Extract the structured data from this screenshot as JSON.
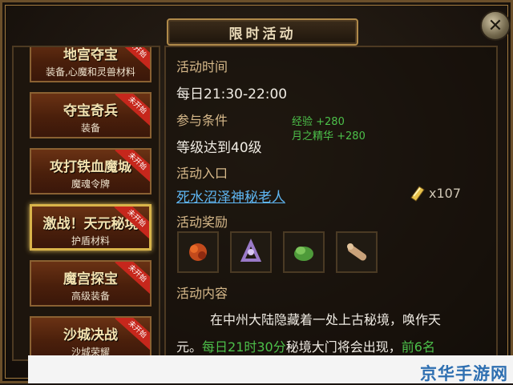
{
  "window": {
    "title": "限时活动",
    "close_symbol": "✕"
  },
  "sidebar": {
    "items": [
      {
        "title": "地宫夺宝",
        "sub": "装备,心魔和灵兽材料",
        "ribbon": "未开始"
      },
      {
        "title": "夺宝奇兵",
        "sub": "装备",
        "ribbon": "未开始"
      },
      {
        "title": "攻打铁血魔城",
        "sub": "魔魂令牌",
        "ribbon": "未开始"
      },
      {
        "title": "激战！天元秘境",
        "sub": "护盾材料",
        "ribbon": "未开始",
        "active": true
      },
      {
        "title": "魔宫探宝",
        "sub": "高级装备",
        "ribbon": "未开始"
      },
      {
        "title": "沙城决战",
        "sub": "沙城荣耀",
        "ribbon": "未开始"
      }
    ]
  },
  "detail": {
    "time_label": "活动时间",
    "time_value": "每日21:30-22:00",
    "condition_label": "参与条件",
    "condition_value": "等级达到40级",
    "exp_bonus": "经验 +280",
    "moon_bonus": "月之精华 +280",
    "entry_label": "活动入口",
    "entry_link": "死水沼泽神秘老人",
    "item_count": "x107",
    "rewards_label": "活动奖励",
    "content_label": "活动内容",
    "content_line1": "在中州大陆隐藏着一处上古秘境，唤作天",
    "content_line2_a": "元。",
    "content_line2_b": "每日21时30分",
    "content_line2_c": "秘境大门将会出现，",
    "content_line2_d": "前6名"
  },
  "rewards": [
    {
      "icon": "red-flower-icon",
      "color": "#c24a1c"
    },
    {
      "icon": "purple-gem-icon",
      "color": "#9a7ac8"
    },
    {
      "icon": "green-herb-icon",
      "color": "#4e9a3a"
    },
    {
      "icon": "wood-scroll-icon",
      "color": "#c9a27a"
    }
  ],
  "watermark": "京华手游网",
  "colors": {
    "accent_green": "#4cc04a",
    "label_gold": "#d7b98a",
    "ribbon_red": "#c6271c"
  }
}
